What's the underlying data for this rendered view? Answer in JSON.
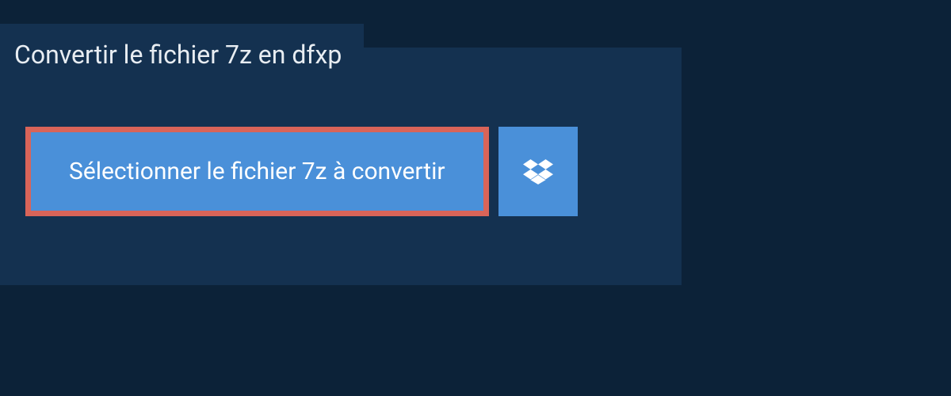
{
  "title": "Convertir le fichier 7z en dfxp",
  "buttons": {
    "select_file_label": "Sélectionner le fichier 7z à convertir"
  }
}
